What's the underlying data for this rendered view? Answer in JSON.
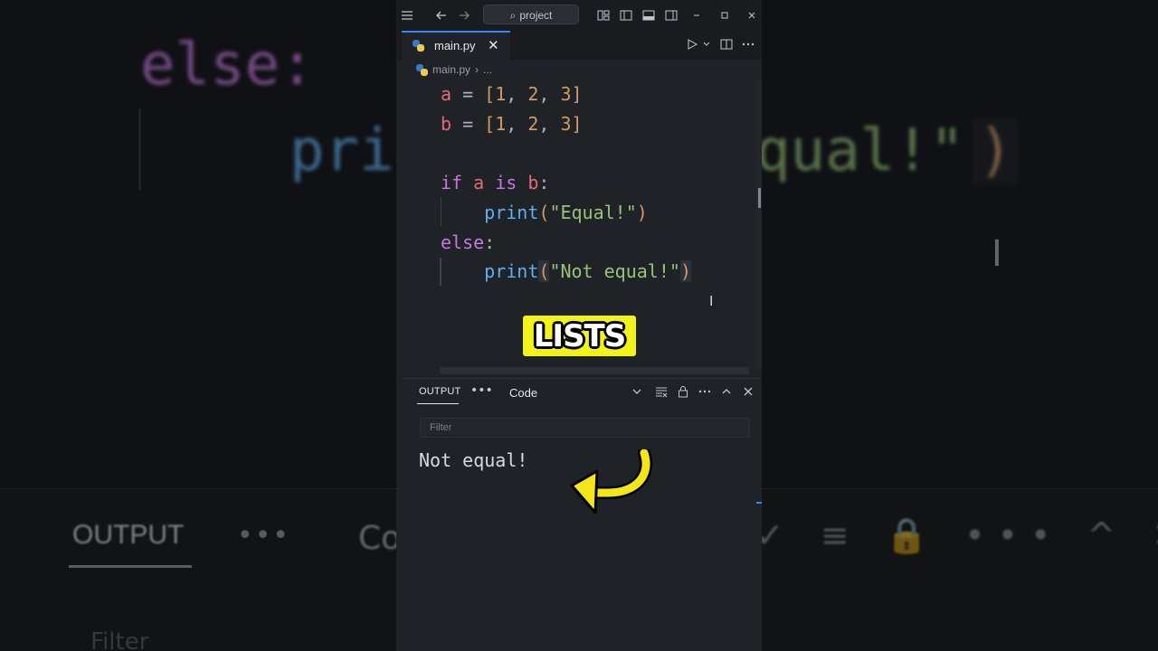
{
  "background_blur": {
    "else_text": "else:",
    "print_fragment": "pri",
    "qual_fragment": "qual!\"",
    "paren_fragment": ")",
    "output_label": "OUTPUT",
    "dots": "•••",
    "co_fragment": "Co",
    "icons": "✓ ≡ 🔒 ••• ^ ✕",
    "filter": "Filter"
  },
  "titlebar": {
    "search_placeholder": "project",
    "icons": [
      "menu-icon",
      "back-arrow-icon",
      "forward-arrow-icon",
      "layout-icon",
      "sidebar-left-icon",
      "panel-bottom-icon",
      "sidebar-right-icon",
      "minimize-icon",
      "maximize-icon",
      "close-icon"
    ]
  },
  "tab": {
    "filename": "main.py",
    "close": "✕"
  },
  "breadcrumb": {
    "file": "main.py",
    "more": "..."
  },
  "code": {
    "line1": [
      "a",
      " = ",
      "[",
      "1",
      ", ",
      "2",
      ", ",
      "3",
      "]"
    ],
    "line2": [
      "b",
      " = ",
      "[",
      "1",
      ", ",
      "2",
      ", ",
      "3",
      "]"
    ],
    "line4": [
      "if",
      " ",
      "a",
      " ",
      "is",
      " ",
      "b",
      ":"
    ],
    "line5": [
      "print",
      "(",
      "\"Equal!\"",
      ")"
    ],
    "line6": [
      "else",
      ":"
    ],
    "line7": [
      "print",
      "(",
      "\"Not equal!\"",
      ")"
    ]
  },
  "badge": {
    "label": "LISTS",
    "color": "#f4f21b"
  },
  "panel": {
    "tab_label": "OUTPUT",
    "more": "•••",
    "channel": "Code",
    "filter_placeholder": "Filter",
    "output_text": "Not equal!"
  },
  "accent_color": "#3b82f6"
}
